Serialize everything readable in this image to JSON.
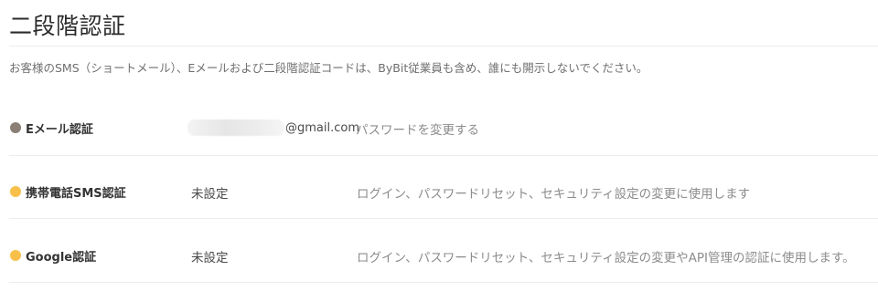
{
  "page": {
    "title": "二段階認証",
    "notice": "お客様のSMS（ショートメール）、Eメールおよび二段階認証コードは、ByBit従業員も含め、誰にも開示しないでください。"
  },
  "colors": {
    "status_set": "#8a7f75",
    "status_unset": "#f7c04a"
  },
  "rows": {
    "email": {
      "label": "Eメール認証",
      "status": "set",
      "email_domain": "@gmail.com",
      "action": "パスワードを変更する"
    },
    "sms": {
      "label": "携帯電話SMS認証",
      "status": "unset",
      "status_text": "未設定",
      "description": "ログイン、パスワードリセット、セキュリティ設定の変更に使用します"
    },
    "google": {
      "label": "Google認証",
      "status": "unset",
      "status_text": "未設定",
      "description": "ログイン、パスワードリセット、セキュリティ設定の変更やAPI管理の認証に使用します。"
    }
  }
}
